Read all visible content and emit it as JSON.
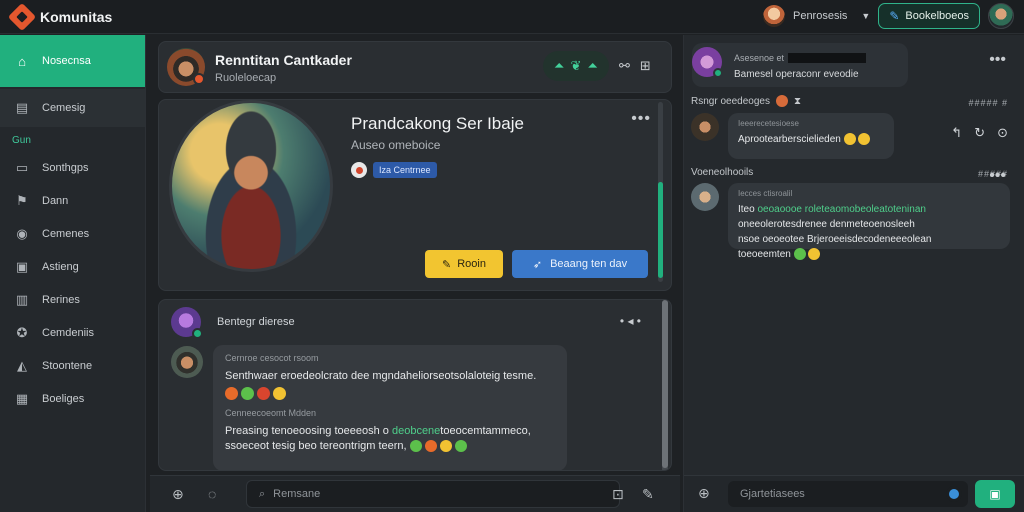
{
  "app": {
    "name": "Komunitas",
    "username": "Penrosesis",
    "action_button": "Bookelboeos"
  },
  "sidebar": {
    "items": [
      {
        "label": "Nosecnsa",
        "icon": "home-icon"
      },
      {
        "label": "Cemesig",
        "icon": "chat-icon"
      }
    ],
    "section": "Gun",
    "sub_items": [
      {
        "label": "Sonthgps",
        "icon": "list-icon"
      },
      {
        "label": "Dann",
        "icon": "flag-icon"
      },
      {
        "label": "Cemenes",
        "icon": "compass-icon"
      },
      {
        "label": "Astieng",
        "icon": "gallery-icon"
      },
      {
        "label": "Rerines",
        "icon": "folder-icon"
      },
      {
        "label": "Cemdeniis",
        "icon": "settings-icon"
      },
      {
        "label": "Stoontene",
        "icon": "triangle-icon"
      },
      {
        "label": "Boeliges",
        "icon": "bookmark-icon"
      }
    ]
  },
  "header": {
    "title": "Renntitan Cantkader",
    "subtitle": "Ruoleloecap"
  },
  "profile": {
    "title": "Prandcakong Ser Ibaje",
    "subtitle": "Auseo omeboice",
    "tag": "Iza Centrnee",
    "btn_primary": "Rooin",
    "btn_secondary": "Beaang ten dav"
  },
  "thread": {
    "title": "Bentegr dierese",
    "messages": [
      {
        "name": "Cernroe cesocot rsoom",
        "text": "Senthwaer eroedeolcrato dee mgndaheliorseotsolaloteig tesme."
      },
      {
        "name": "Cenneecoeomt Mdden",
        "text_a": "Preasing tenoeoosing toeeeosh o ",
        "text_green": "deobcene",
        "text_b": "toeocemtammeco,",
        "text_c": "ssoeceot tesig beo tereontrigm teern,"
      }
    ]
  },
  "composer": {
    "placeholder": "Remsane"
  },
  "right": {
    "head_name": "Asesenoe et",
    "head_sub": "Bamesel operaconr eveodie",
    "sec1": "Rsngr oeedeoges",
    "sec1_right": "##### #",
    "msg1_name": "Ieeerecetesioese",
    "msg1_text": "Aprootearberscielieden",
    "sec2": "Voeneolhooils",
    "sec2_right": "#####",
    "msg2_name": "Iecces ctisroalil",
    "msg2_text_a": "Iteo ",
    "msg2_text_green": "oeoaoooe roleteaomobeoleatoteninan",
    "msg2_text_b": "oneeolerotesdrenee denmeteoenosleeh",
    "msg2_text_c": "nsoe oeoeotee Brjeroeeisdecodeneeeolean",
    "msg2_text_d": "toeoeemten",
    "composer_placeholder": "Gjartetiasees"
  }
}
